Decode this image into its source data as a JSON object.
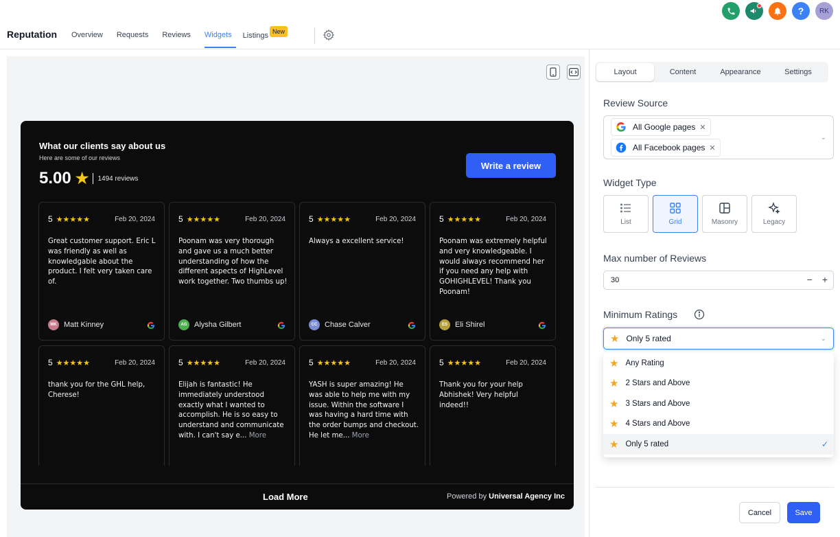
{
  "header": {
    "brand": "Reputation",
    "tabs": [
      {
        "label": "Overview"
      },
      {
        "label": "Requests"
      },
      {
        "label": "Reviews"
      },
      {
        "label": "Widgets"
      },
      {
        "label": "Listings"
      }
    ],
    "active_tab": "Widgets",
    "listings_badge": "New",
    "user_initials": "RK",
    "help_icon_text": "?"
  },
  "widget": {
    "title": "What our clients say about us",
    "subtitle": "Here are some of our reviews",
    "score": "5.00",
    "review_count": "1494 reviews",
    "write_button": "Write a review",
    "load_more": "Load More",
    "powered_prefix": "Powered by",
    "powered_brand": "Universal Agency Inc",
    "reviews": [
      {
        "rating": "5",
        "date": "Feb 20, 2024",
        "text": "Great customer support. Eric L was friendly as well as knowledgable about the product. I felt very taken care of.",
        "more": "",
        "author": "Matt Kinney",
        "initials": "MK",
        "avatar_color": "#c77b8e"
      },
      {
        "rating": "5",
        "date": "Feb 20, 2024",
        "text": "Poonam was very thorough and gave us a much better understanding of how the different aspects of HighLevel work together. Two thumbs up!",
        "more": "",
        "author": "Alysha Gilbert",
        "initials": "AG",
        "avatar_color": "#4caf50"
      },
      {
        "rating": "5",
        "date": "Feb 20, 2024",
        "text": "Always a excellent service!",
        "more": "",
        "author": "Chase Calver",
        "initials": "CC",
        "avatar_color": "#7b8ed6"
      },
      {
        "rating": "5",
        "date": "Feb 20, 2024",
        "text": "Poonam was extremely helpful and very knowledgeable. I would always recommend her if you need any help with GOHIGHLEVEL! Thank you Poonam!",
        "more": "",
        "author": "Eli Shirel",
        "initials": "ES",
        "avatar_color": "#b5a03a"
      },
      {
        "rating": "5",
        "date": "Feb 20, 2024",
        "text": "thank you for the GHL help, Cherese!",
        "more": "",
        "author": "",
        "initials": "",
        "avatar_color": "#c77b8e"
      },
      {
        "rating": "5",
        "date": "Feb 20, 2024",
        "text": "Elijah is fantastic! He immediately understood exactly what I wanted to accomplish. He is so easy to understand and communicate with. I can't say e...",
        "more": "More",
        "author": "",
        "initials": "",
        "avatar_color": "#4caf50"
      },
      {
        "rating": "5",
        "date": "Feb 20, 2024",
        "text": "YASH is super amazing! He was able to help me with my issue. Within the software I was having a hard time with the order bumps and checkout. He let me...",
        "more": "More",
        "author": "",
        "initials": "",
        "avatar_color": "#5fa8a0"
      },
      {
        "rating": "5",
        "date": "Feb 20, 2024",
        "text": "Thank you for your help Abhishek! Very helpful indeed!!",
        "more": "",
        "author": "",
        "initials": "",
        "avatar_color": "#b5a03a"
      }
    ]
  },
  "panel": {
    "tabs": [
      {
        "label": "Layout"
      },
      {
        "label": "Content"
      },
      {
        "label": "Appearance"
      },
      {
        "label": "Settings"
      }
    ],
    "review_source_label": "Review Source",
    "sources": [
      {
        "label": "All Google pages",
        "icon": "google-icon"
      },
      {
        "label": "All Facebook pages",
        "icon": "facebook-icon"
      }
    ],
    "widget_type_label": "Widget Type",
    "widget_types": [
      {
        "label": "List",
        "icon": "list-icon"
      },
      {
        "label": "Grid",
        "icon": "grid-icon"
      },
      {
        "label": "Masonry",
        "icon": "masonry-icon"
      },
      {
        "label": "Legacy",
        "icon": "sparkle-icon"
      }
    ],
    "active_widget_type": "Grid",
    "max_reviews_label": "Max number of Reviews",
    "max_reviews_value": "30",
    "min_ratings_label": "Minimum Ratings",
    "min_ratings_selected": "Only 5 rated",
    "rating_options": [
      {
        "label": "Any Rating"
      },
      {
        "label": "2 Stars and Above"
      },
      {
        "label": "3 Stars and Above"
      },
      {
        "label": "4 Stars and Above"
      },
      {
        "label": "Only 5 rated"
      }
    ],
    "cancel_label": "Cancel",
    "save_label": "Save"
  },
  "colors": {
    "accent": "#2f5ff5",
    "star": "#f5c518",
    "widget_bg": "#0c0c0c"
  }
}
